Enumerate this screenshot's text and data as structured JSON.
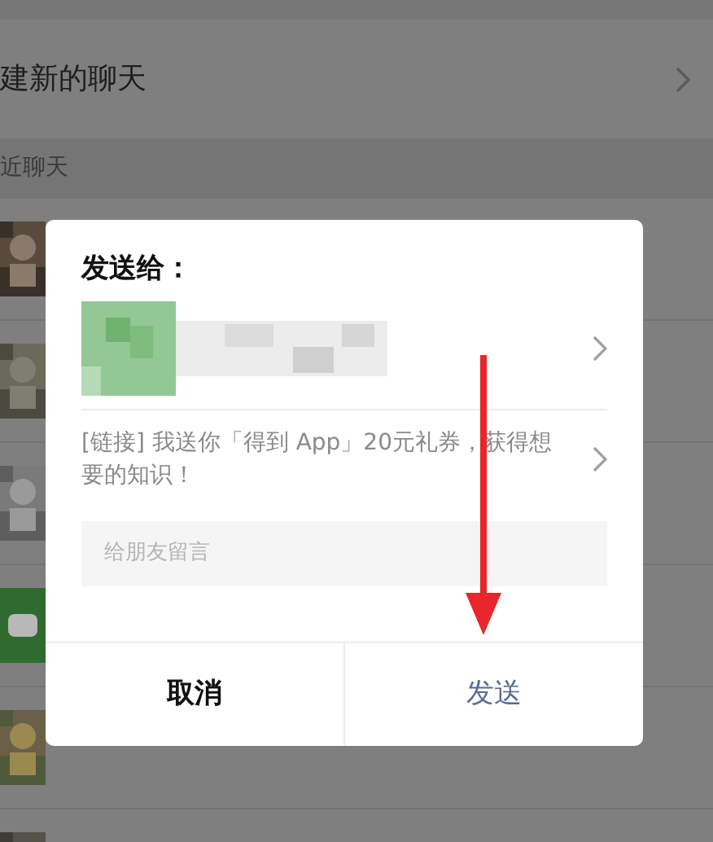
{
  "background": {
    "new_chat": {
      "label": "建新的聊天"
    },
    "section_header": "近聊天",
    "chats": [
      {
        "kind": "picture"
      },
      {
        "kind": "picture"
      },
      {
        "kind": "picture"
      },
      {
        "kind": "folder"
      },
      {
        "kind": "picture"
      },
      {
        "kind": "picture"
      }
    ]
  },
  "dialog": {
    "title": "发送给：",
    "recipient": {
      "kind": "picture"
    },
    "message": "[链接] 我送你「得到 App」20元礼券，获得想要的知识！",
    "comment": {
      "placeholder": "给朋友留言"
    },
    "buttons": [
      {
        "label": "取消",
        "kind": "cancel"
      },
      {
        "label": "发送",
        "kind": "send"
      }
    ]
  },
  "annotation": {
    "kind": "arrow"
  }
}
